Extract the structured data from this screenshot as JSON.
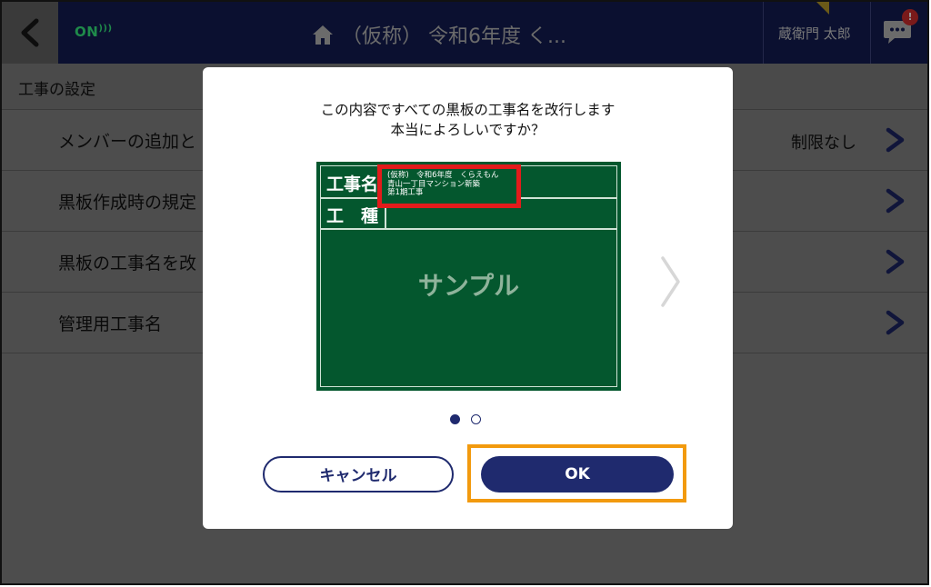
{
  "topbar": {
    "status": "ON",
    "title": "（仮称） 令和6年度 く...",
    "user_name": "蔵衛門 太郎",
    "badge": "!"
  },
  "settings": {
    "section_title": "工事の設定",
    "rows": [
      {
        "label": "メンバーの追加と",
        "value": "制限なし"
      },
      {
        "label": "黒板作成時の規定",
        "value": ""
      },
      {
        "label": "黒板の工事名を改",
        "value": ""
      },
      {
        "label": "管理用工事名",
        "value": ""
      }
    ]
  },
  "dialog": {
    "message_line1": "この内容ですべての黒板の工事名を改行します",
    "message_line2": "本当によろしいですか？",
    "board": {
      "label_koujimei": "工事名",
      "label_koushu": "工　種",
      "name_line1": "(仮称)　令和6年度　くらえもん",
      "name_line2": "青山一丁目マンション新築",
      "name_line3": "第1期工事",
      "sample_text": "サンプル"
    },
    "page_count": 2,
    "current_page": 1,
    "cancel_label": "キャンセル",
    "ok_label": "OK"
  },
  "colors": {
    "navy": "#1f2a6e",
    "board_green": "#04572e",
    "highlight_red": "#e21b1b",
    "highlight_orange": "#f29a0e"
  },
  "icons": {
    "back": "chevron-left-icon",
    "home": "home-icon",
    "wifi": "wifi-icon",
    "chat": "chat-bubble-icon",
    "row_chevron": "chevron-right-icon",
    "carousel_next": "chevron-right-icon"
  }
}
